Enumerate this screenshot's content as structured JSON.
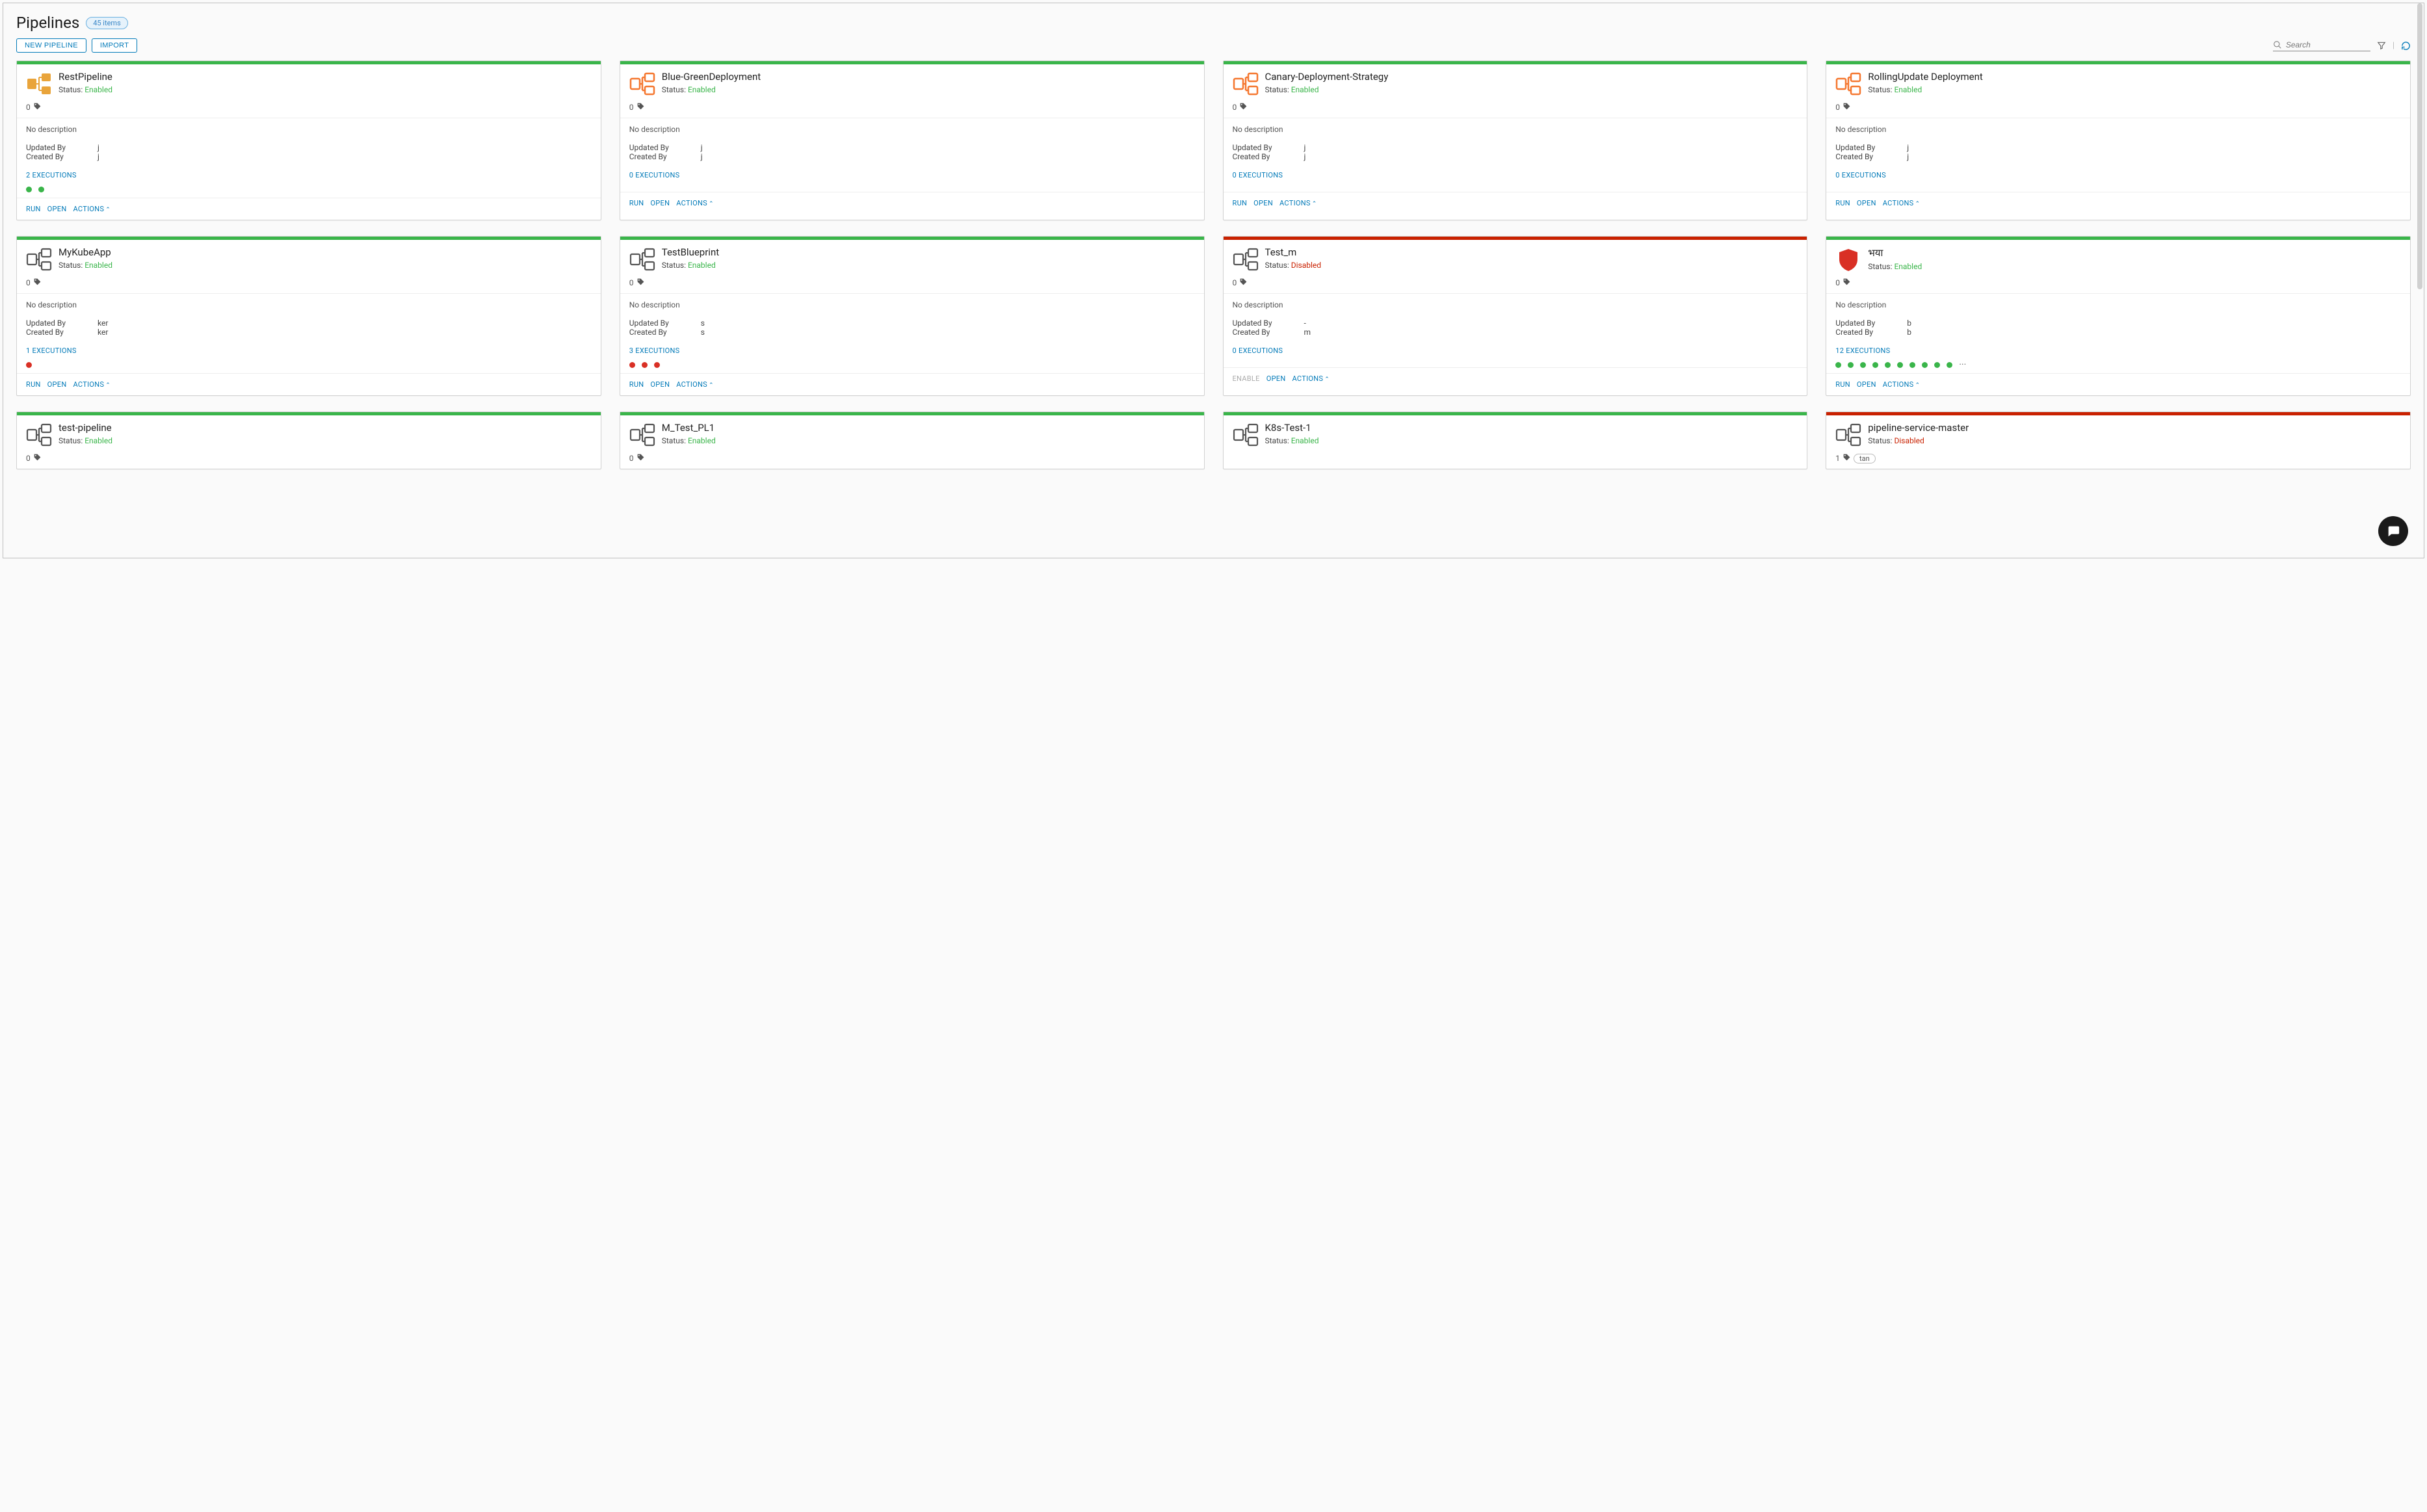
{
  "header": {
    "title": "Pipelines",
    "items_badge": "45 items"
  },
  "toolbar": {
    "new_pipeline": "NEW PIPELINE",
    "import": "IMPORT",
    "search_placeholder": "Search"
  },
  "icons": {
    "filter": "filter",
    "refresh": "refresh",
    "search": "search"
  },
  "labels": {
    "status": "Status:",
    "no_desc": "No description",
    "updated_by": "Updated By",
    "created_by": "Created By",
    "run": "RUN",
    "open": "OPEN",
    "actions": "ACTIONS",
    "enable": "ENABLE"
  },
  "cards": [
    {
      "name": "RestPipeline",
      "status": "Enabled",
      "status_cls": "enabled",
      "icon_variant": "yellow",
      "topbar": "green",
      "tag_count": "0",
      "desc": "No description",
      "updated_by": "j",
      "created_by": "j",
      "executions_label": "2 EXECUTIONS",
      "dots": [
        "green",
        "green"
      ],
      "dots_more": false,
      "footer_run": true
    },
    {
      "name": "Blue-GreenDeployment",
      "status": "Enabled",
      "status_cls": "enabled",
      "icon_variant": "orange",
      "topbar": "green",
      "tag_count": "0",
      "desc": "No description",
      "updated_by": "j",
      "created_by": "j",
      "executions_label": "0 EXECUTIONS",
      "dots": [],
      "dots_more": false,
      "footer_run": true
    },
    {
      "name": "Canary-Deployment-Strategy",
      "status": "Enabled",
      "status_cls": "enabled",
      "icon_variant": "orange",
      "topbar": "green",
      "tag_count": "0",
      "desc": "No description",
      "updated_by": "j",
      "created_by": "j",
      "executions_label": "0 EXECUTIONS",
      "dots": [],
      "dots_more": false,
      "footer_run": true
    },
    {
      "name": "RollingUpdate Deployment",
      "status": "Enabled",
      "status_cls": "enabled",
      "icon_variant": "orange",
      "topbar": "green",
      "tag_count": "0",
      "desc": "No description",
      "updated_by": "j",
      "created_by": "j",
      "executions_label": "0 EXECUTIONS",
      "dots": [],
      "dots_more": false,
      "footer_run": true
    },
    {
      "name": "MyKubeApp",
      "status": "Enabled",
      "status_cls": "enabled",
      "icon_variant": "pipeline",
      "topbar": "green",
      "tag_count": "0",
      "desc": "No description",
      "updated_by": "ker",
      "created_by": "ker",
      "executions_label": "1 EXECUTIONS",
      "dots": [
        "red"
      ],
      "dots_more": false,
      "footer_run": true
    },
    {
      "name": "TestBlueprint",
      "status": "Enabled",
      "status_cls": "enabled",
      "icon_variant": "pipeline",
      "topbar": "green",
      "tag_count": "0",
      "desc": "No description",
      "updated_by": "s",
      "created_by": "s",
      "executions_label": "3 EXECUTIONS",
      "dots": [
        "red",
        "red",
        "red"
      ],
      "dots_more": false,
      "footer_run": true
    },
    {
      "name": "Test_m",
      "status": "Disabled",
      "status_cls": "disabled",
      "icon_variant": "pipeline",
      "topbar": "red",
      "tag_count": "0",
      "desc": "No description",
      "updated_by": "-",
      "created_by": "m",
      "executions_label": "0 EXECUTIONS",
      "dots": [],
      "dots_more": false,
      "footer_run": false
    },
    {
      "name": "भया",
      "status": "Enabled",
      "status_cls": "enabled",
      "icon_variant": "shield",
      "topbar": "green",
      "tag_count": "0",
      "desc": "No description",
      "updated_by": "b",
      "created_by": "b",
      "executions_label": "12 EXECUTIONS",
      "dots": [
        "green",
        "green",
        "green",
        "green",
        "green",
        "green",
        "green",
        "green",
        "green",
        "green"
      ],
      "dots_more": true,
      "footer_run": true
    },
    {
      "name": "test-pipeline",
      "status": "Enabled",
      "status_cls": "enabled",
      "icon_variant": "pipeline",
      "topbar": "green",
      "tag_count": "0",
      "partial": true
    },
    {
      "name": "M_Test_PL1",
      "status": "Enabled",
      "status_cls": "enabled",
      "icon_variant": "pipeline",
      "topbar": "green",
      "tag_count": "0",
      "partial": true
    },
    {
      "name": "K8s-Test-1",
      "status": "Enabled",
      "status_cls": "enabled",
      "icon_variant": "pipeline",
      "topbar": "green",
      "tag_count": "",
      "partial": true,
      "hide_tag_row": true
    },
    {
      "name": "pipeline-service-master",
      "status": "Disabled",
      "status_cls": "disabled",
      "icon_variant": "pipeline",
      "topbar": "red",
      "tag_count": "1",
      "tag_text": "tan",
      "partial": true
    }
  ]
}
